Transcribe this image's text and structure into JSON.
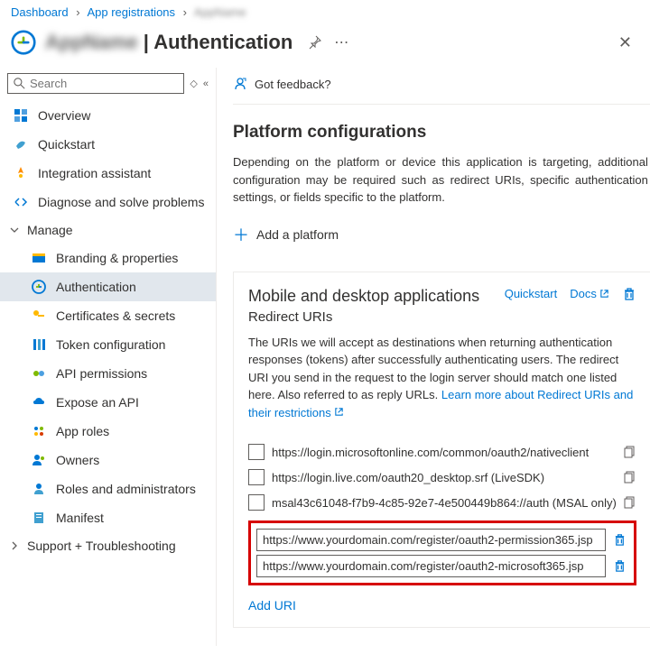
{
  "breadcrumb": {
    "dashboard": "Dashboard",
    "appregs": "App registrations",
    "current": "AppName"
  },
  "title": {
    "app": "AppName",
    "page": "Authentication"
  },
  "search": {
    "placeholder": "Search"
  },
  "nav": {
    "overview": "Overview",
    "quickstart": "Quickstart",
    "integration": "Integration assistant",
    "diagnose": "Diagnose and solve problems",
    "manage": "Manage",
    "branding": "Branding & properties",
    "auth": "Authentication",
    "certs": "Certificates & secrets",
    "token": "Token configuration",
    "api_perm": "API permissions",
    "expose": "Expose an API",
    "approles": "App roles",
    "owners": "Owners",
    "roles": "Roles and administrators",
    "manifest": "Manifest",
    "support": "Support + Troubleshooting"
  },
  "feedback": "Got feedback?",
  "platform": {
    "heading": "Platform configurations",
    "desc": "Depending on the platform or device this application is targeting, additional configuration may be required such as redirect URIs, specific authentication settings, or fields specific to the platform.",
    "add": "Add a platform"
  },
  "card": {
    "title": "Mobile and desktop applications",
    "quickstart": "Quickstart",
    "docs": "Docs",
    "subtitle": "Redirect URIs",
    "desc": "The URIs we will accept as destinations when returning authentication responses (tokens) after successfully authenticating users. The redirect URI you send in the request to the login server should match one listed here. Also referred to as reply URLs. ",
    "learn": "Learn more about Redirect URIs and their restrictions",
    "uris": {
      "u1": "https://login.microsoftonline.com/common/oauth2/nativeclient",
      "u2": "https://login.live.com/oauth20_desktop.srf (LiveSDK)",
      "u3": "msal43c61048-f7b9-4c85-92e7-4e500449b864://auth (MSAL only)"
    },
    "custom": {
      "c1": "https://www.yourdomain.com/register/oauth2-permission365.jsp",
      "c2": "https://www.yourdomain.com/register/oauth2-microsoft365.jsp"
    },
    "add_uri": "Add URI"
  }
}
